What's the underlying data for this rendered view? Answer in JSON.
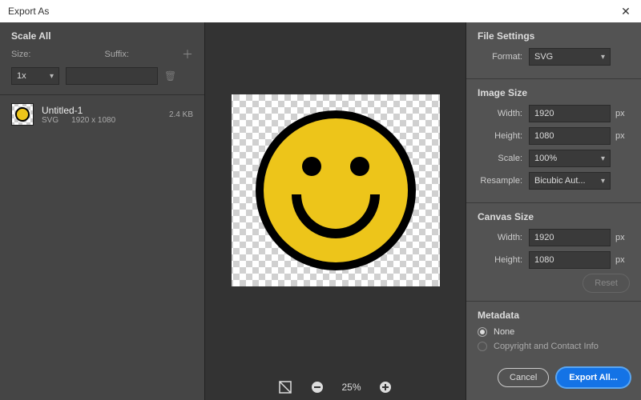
{
  "window": {
    "title": "Export As"
  },
  "scale_all": {
    "title": "Scale All",
    "size_label": "Size:",
    "suffix_label": "Suffix:",
    "size_value": "1x",
    "suffix_value": ""
  },
  "file": {
    "name": "Untitled-1",
    "format": "SVG",
    "dimensions": "1920 x 1080",
    "filesize": "2.4 KB"
  },
  "preview": {
    "zoom": "25%"
  },
  "file_settings": {
    "title": "File Settings",
    "format_label": "Format:",
    "format_value": "SVG"
  },
  "image_size": {
    "title": "Image Size",
    "width_label": "Width:",
    "height_label": "Height:",
    "scale_label": "Scale:",
    "resample_label": "Resample:",
    "width": "1920",
    "height": "1080",
    "scale": "100%",
    "resample": "Bicubic Aut...",
    "unit": "px"
  },
  "canvas_size": {
    "title": "Canvas Size",
    "width_label": "Width:",
    "height_label": "Height:",
    "width": "1920",
    "height": "1080",
    "unit": "px",
    "reset_label": "Reset"
  },
  "metadata": {
    "title": "Metadata",
    "none_label": "None",
    "copyright_label": "Copyright and Contact Info",
    "selected": "none"
  },
  "footer": {
    "cancel": "Cancel",
    "export": "Export All..."
  }
}
